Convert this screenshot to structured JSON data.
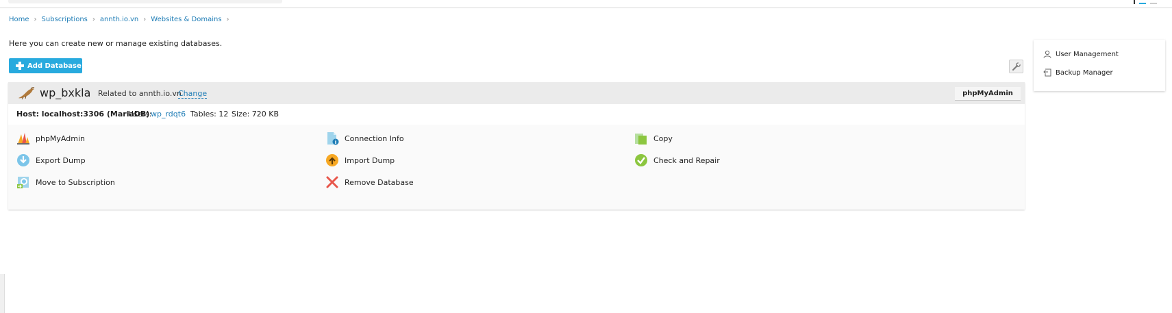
{
  "breadcrumb": [
    {
      "label": "Home"
    },
    {
      "label": "Subscriptions"
    },
    {
      "label": "annth.io.vn"
    },
    {
      "label": "Websites & Domains"
    }
  ],
  "breadcrumb_sep": "›",
  "intro_text": "Here you can create new or manage existing databases.",
  "add_database_label": "Add Database",
  "database": {
    "name": "wp_bxkla",
    "related_text": "Related to annth.io.vn",
    "change_label": "Change",
    "phpmyadmin_button": "phpMyAdmin",
    "host_text": "Host: localhost:3306 (MariaDB)",
    "users_label": "Users:",
    "users_value": "wp_rdqt6",
    "tables_text": "Tables: 12",
    "size_text": "Size: 720 KB"
  },
  "actions": [
    {
      "label": "phpMyAdmin",
      "icon": "phpmyadmin-icon"
    },
    {
      "label": "Connection Info",
      "icon": "connection-info-icon"
    },
    {
      "label": "Copy",
      "icon": "copy-icon"
    },
    {
      "label": "Export Dump",
      "icon": "export-dump-icon"
    },
    {
      "label": "Import Dump",
      "icon": "import-dump-icon"
    },
    {
      "label": "Check and Repair",
      "icon": "check-repair-icon"
    },
    {
      "label": "Move to Subscription",
      "icon": "move-subscription-icon"
    },
    {
      "label": "Remove Database",
      "icon": "remove-icon"
    }
  ],
  "side_panel": {
    "items": [
      {
        "label": "User Management",
        "icon": "user-icon"
      },
      {
        "label": "Backup Manager",
        "icon": "backup-icon"
      }
    ]
  },
  "colors": {
    "accent": "#28aade",
    "link": "#1f7db6",
    "header_bg": "#ebebeb",
    "check_green": "#8cc63f",
    "remove_red": "#e8564b",
    "import_orange": "#f7a823"
  }
}
